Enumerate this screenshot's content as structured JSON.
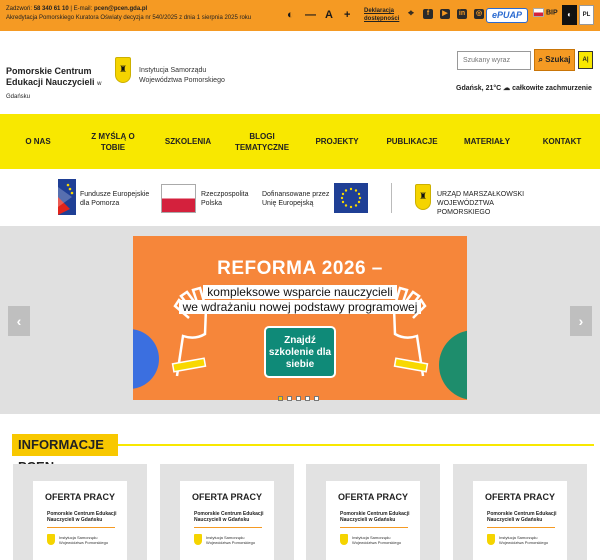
{
  "topbar": {
    "phone_label": "Zadzwoń:",
    "phone": "58 340 61 10",
    "email_label": "E-mail:",
    "email": "pcen@pcen.gda.pl",
    "accreditation": "Akredytacja Pomorskiego Kuratora Oświaty decyzja nr 540/2025 z dnia 1 sierpnia 2025 roku",
    "contrast_icon": "◐",
    "font_decrease": "—",
    "font_normal": "A",
    "font_increase": "+",
    "declaration": "Deklaracja dostępności",
    "epuap": "ePUAP",
    "bip": "BIP",
    "lang": "PL",
    "icons": [
      "map-pin-icon",
      "facebook-icon",
      "youtube-icon",
      "linkedin-icon",
      "instagram-icon"
    ]
  },
  "header": {
    "org_name": "Pomorskie Centrum Edukacji Nauczycieli",
    "org_city": "w Gdańsku",
    "institution_line1": "Instytucja Samorządu",
    "institution_line2": "Województwa Pomorskiego",
    "search_placeholder": "Szukany wyraz",
    "search_button": "Szukaj",
    "a11y_button": "A|",
    "weather": "Gdańsk, 21°C ☁ całkowite zachmurzenie"
  },
  "nav": [
    {
      "label": "O NAS"
    },
    {
      "label": "Z MYŚLĄ O TOBIE"
    },
    {
      "label": "SZKOLENIA"
    },
    {
      "label": "BLOGI TEMATYCZNE"
    },
    {
      "label": "PROJEKTY"
    },
    {
      "label": "PUBLIKACJE"
    },
    {
      "label": "MATERIAŁY"
    },
    {
      "label": "KONTAKT"
    }
  ],
  "eu_logos": {
    "fe": "Fundusze Europejskie dla Pomorza",
    "rp": "Rzeczpospolita Polska",
    "eu": "Dofinansowane przez Unię Europejską",
    "um": "URZĄD MARSZAŁKOWSKI WOJEWÓDZTWA POMORSKIEGO"
  },
  "slider": {
    "title": "REFORMA 2026 –",
    "subtitle_line1": "kompleksowe wsparcie nauczycieli",
    "subtitle_line2": "we wdrażaniu nowej podstawy programowej",
    "bubble": "Znajdź szkolenie dla siebie",
    "prev": "‹",
    "next": "›",
    "slide_count": 5,
    "active_slide": 1
  },
  "info": {
    "section_title": "INFORMACJE PCEN",
    "cards": [
      {
        "title": "OFERTA PRACY",
        "org": "Pomorskie Centrum Edukacji Nauczycieli w Gdańsku",
        "inst": "Instytucja Samorządu Województwa Pomorskiego"
      },
      {
        "title": "OFERTA PRACY",
        "org": "Pomorskie Centrum Edukacji Nauczycieli w Gdańsku",
        "inst": "Instytucja Samorządu Województwa Pomorskiego"
      },
      {
        "title": "OFERTA PRACY",
        "org": "Pomorskie Centrum Edukacji Nauczycieli w Gdańsku",
        "inst": "Instytucja Samorządu Województwa Pomorskiego"
      },
      {
        "title": "OFERTA PRACY",
        "org": "Pomorskie Centrum Edukacji Nauczycieli w Gdańsku",
        "inst": "Instytucja Samorządu Województwa Pomorskiego"
      }
    ]
  },
  "colors": {
    "accent_orange": "#f59a23",
    "nav_yellow": "#f8e800",
    "slide_orange": "#f6863a",
    "bubble_teal": "#0f8a78"
  }
}
